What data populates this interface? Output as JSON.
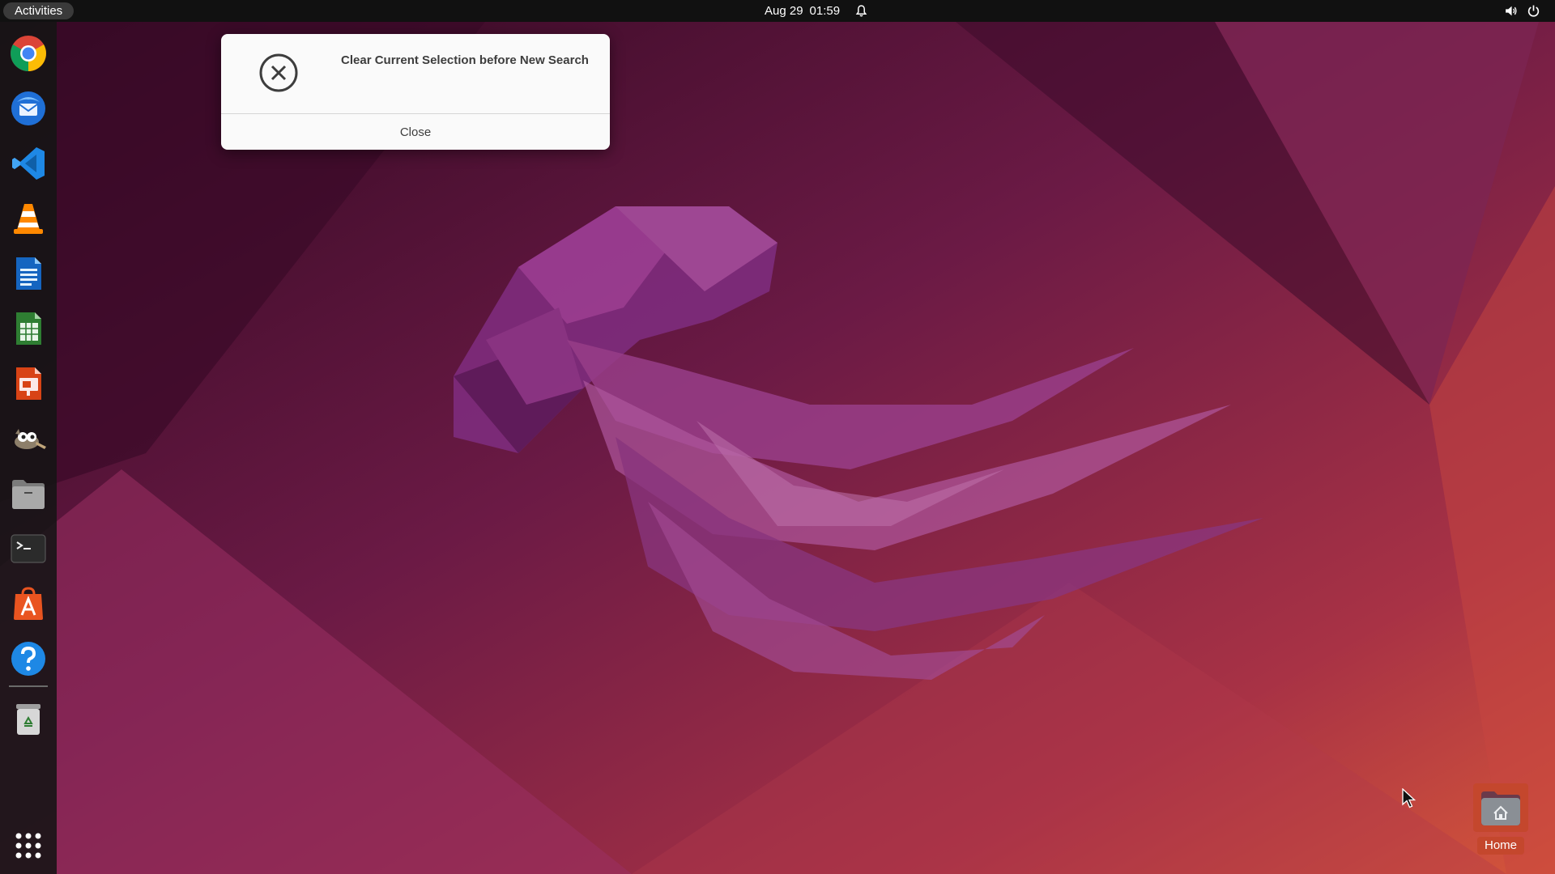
{
  "topbar": {
    "activities_label": "Activities",
    "date": "Aug 29",
    "time": "01:59",
    "icons": [
      "notification-bell-icon",
      "volume-icon",
      "power-icon"
    ]
  },
  "dock": {
    "apps": [
      {
        "name": "Google Chrome",
        "icon": "chrome-icon"
      },
      {
        "name": "Thunderbird Mail",
        "icon": "thunderbird-icon"
      },
      {
        "name": "Visual Studio Code",
        "icon": "vscode-icon"
      },
      {
        "name": "VLC media player",
        "icon": "vlc-icon"
      },
      {
        "name": "LibreOffice Writer",
        "icon": "writer-icon"
      },
      {
        "name": "LibreOffice Calc",
        "icon": "calc-icon"
      },
      {
        "name": "LibreOffice Impress",
        "icon": "impress-icon"
      },
      {
        "name": "GNU Image Manipulation Program",
        "icon": "gimp-icon"
      },
      {
        "name": "Files",
        "icon": "files-icon"
      },
      {
        "name": "Terminal",
        "icon": "terminal-icon"
      },
      {
        "name": "Ubuntu Software",
        "icon": "software-icon"
      },
      {
        "name": "Help",
        "icon": "help-icon"
      },
      {
        "name": "Trash",
        "icon": "trash-icon"
      }
    ],
    "show_apps_icon": "app-grid-icon"
  },
  "dialog": {
    "icon": "error-circle-x-icon",
    "message": "Clear Current Selection before New Search",
    "close_label": "Close"
  },
  "desktop": {
    "home_label": "Home",
    "home_icon": "home-folder-icon"
  },
  "colors": {
    "topbar_bg": "#111111",
    "dock_bg": "#141414",
    "wallpaper_dark": "#3a0a26",
    "wallpaper_mid": "#7a1f4a",
    "wallpaper_warm": "#d2553a",
    "selection_orange": "#c4472d",
    "dialog_bg": "#fafafa"
  }
}
